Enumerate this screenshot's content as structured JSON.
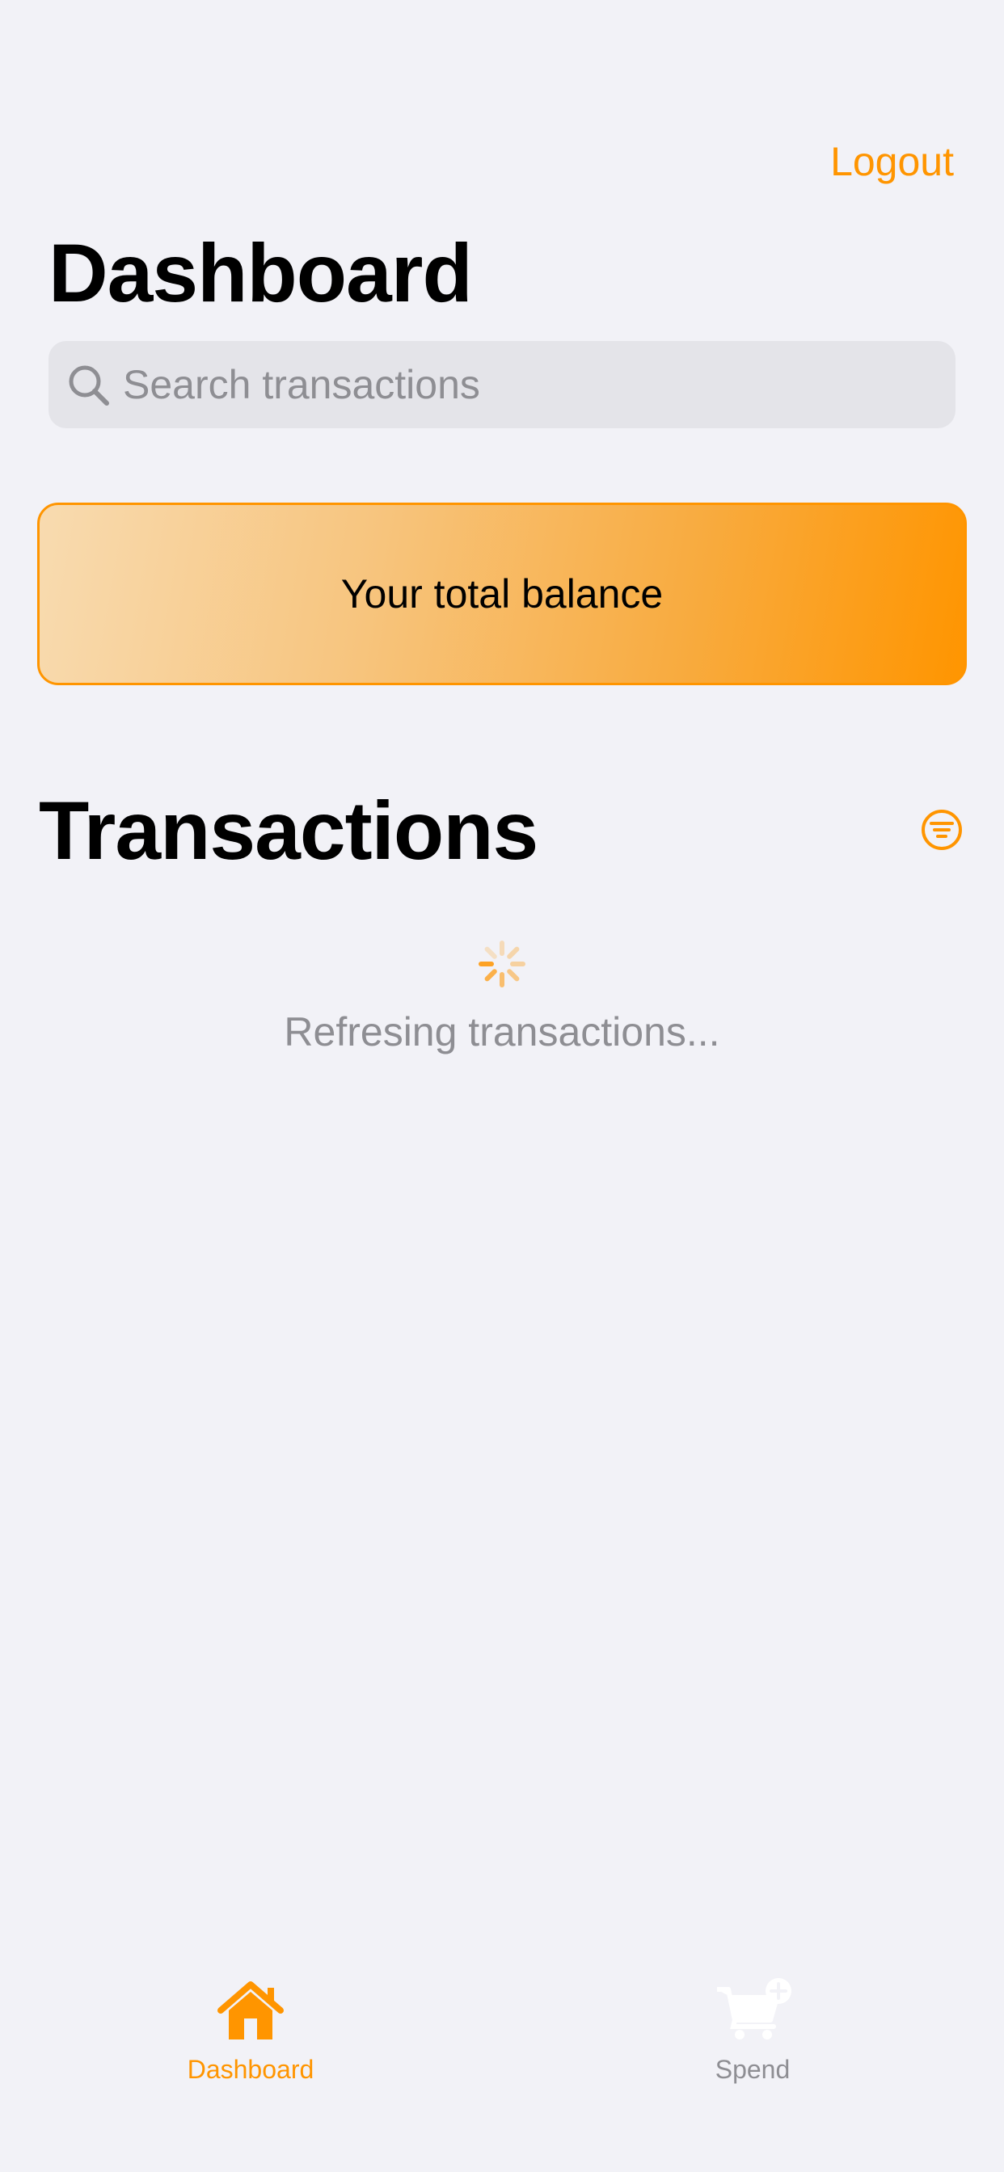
{
  "header": {
    "logout_label": "Logout",
    "title": "Dashboard"
  },
  "search": {
    "placeholder": "Search transactions",
    "value": ""
  },
  "balance_card": {
    "label": "Your total balance"
  },
  "transactions": {
    "title": "Transactions",
    "loading_text": "Refresing transactions..."
  },
  "tab_bar": {
    "tabs": [
      {
        "label": "Dashboard",
        "icon": "house-icon",
        "selected": true
      },
      {
        "label": "Spend",
        "icon": "cart-add-icon",
        "selected": false
      }
    ]
  },
  "colors": {
    "accent": "#ff9500",
    "background": "#f2f2f7",
    "secondary_text": "#8e8e93",
    "search_fill": "#e4e4e9"
  },
  "icons": {
    "search": "magnifying-glass-icon",
    "filter": "filter-circle-icon",
    "spinner": "activity-spinner-icon"
  }
}
